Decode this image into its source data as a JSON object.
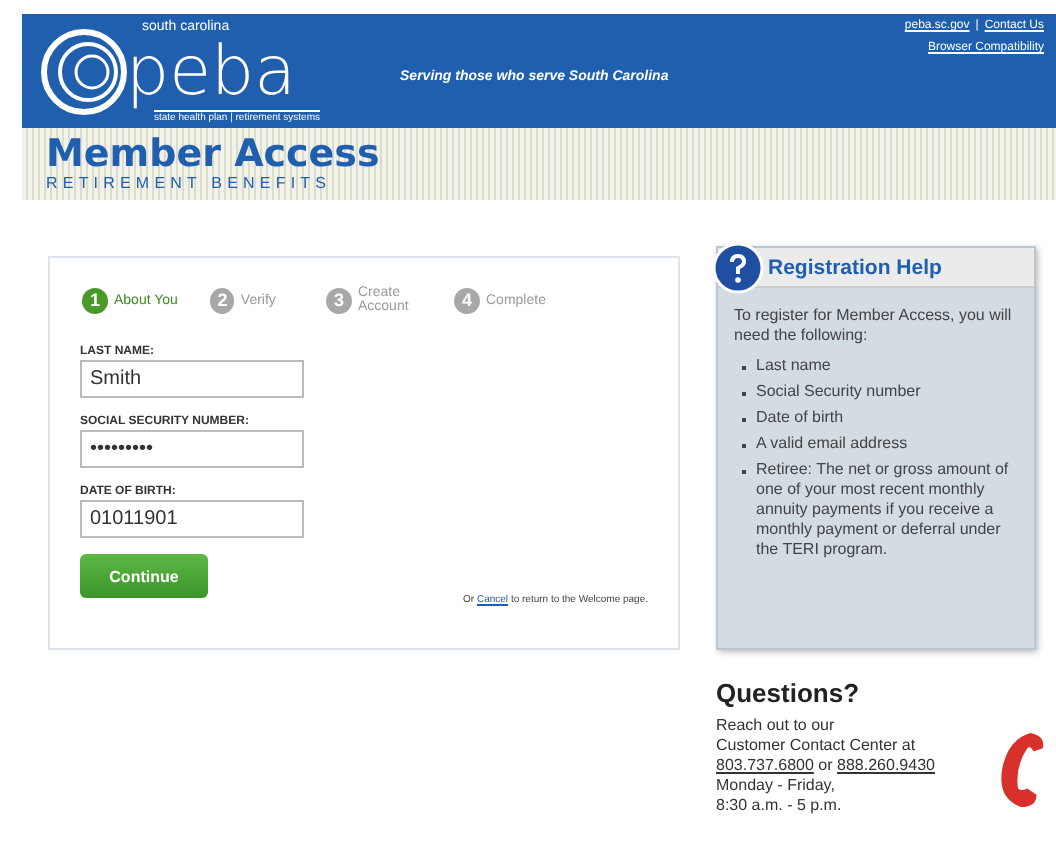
{
  "header": {
    "logo_top": "south carolina",
    "logo_word": "peba",
    "logo_sub": "state health plan | retirement systems",
    "tagline": "Serving those who serve South Carolina",
    "links": [
      "peba.sc.gov",
      "Contact Us"
    ],
    "separator": "|",
    "compat_link": "Browser Compatibility"
  },
  "banner": {
    "title": "Member Access",
    "subtitle": "RETIREMENT BENEFITS"
  },
  "steps": [
    {
      "number": "1",
      "label": "About You",
      "selected": true
    },
    {
      "number": "2",
      "label": "Verify",
      "selected": false
    },
    {
      "number": "3",
      "label": "Create Account",
      "selected": false
    },
    {
      "number": "4",
      "label": "Complete",
      "selected": false
    }
  ],
  "fields": [
    {
      "label": "LAST NAME:",
      "value": "Smith"
    },
    {
      "label": "SOCIAL SECURITY NUMBER:",
      "value": "•••••••••"
    },
    {
      "label": "DATE OF BIRTH:",
      "value": "01011901"
    }
  ],
  "continue_button": "Continue",
  "cancel_note": {
    "before": "Or",
    "link": "Cancel",
    "after": "to return to the Welcome page."
  },
  "help": {
    "title": "Registration Help",
    "intro": "To register for Member Access, you will need the following:",
    "items": [
      "Last name",
      "Social Security number",
      "Date of birth",
      "A valid email address",
      "Retiree: The net or gross amount of one of your most recent monthly annuity payments if you receive a monthly payment or deferral under the TERI program."
    ]
  },
  "questions": {
    "title": "Questions?",
    "lines": [
      "Reach out to our",
      "Customer Contact Center at"
    ],
    "phone_1": "803.737.6800",
    "between": "or",
    "phone_2": "888.260.9430",
    "hours": [
      "Monday - Friday,",
      "8:30 a.m. - 5 p.m."
    ]
  }
}
